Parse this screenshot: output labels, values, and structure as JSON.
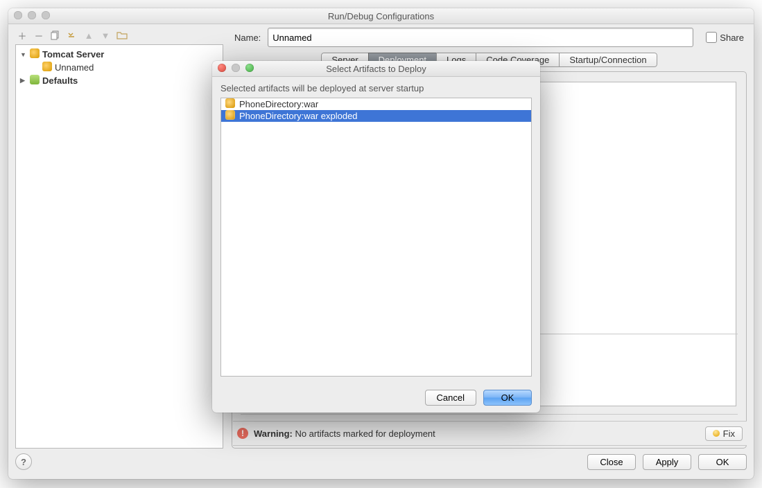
{
  "window": {
    "title": "Run/Debug Configurations"
  },
  "sidebar": {
    "items": [
      {
        "label": "Tomcat Server"
      },
      {
        "label": "Unnamed"
      },
      {
        "label": "Defaults"
      }
    ]
  },
  "main": {
    "name_label": "Name:",
    "name_value": "Unnamed",
    "share_label": "Share",
    "tabs": [
      {
        "label": "Server"
      },
      {
        "label": "Deployment"
      },
      {
        "label": "Logs"
      },
      {
        "label": "Code Coverage"
      },
      {
        "label": "Startup/Connection"
      }
    ]
  },
  "warning": {
    "prefix": "Warning:",
    "text": " No artifacts marked for deployment",
    "fix_label": "Fix"
  },
  "buttons": {
    "close": "Close",
    "apply": "Apply",
    "ok": "OK"
  },
  "modal": {
    "title": "Select Artifacts to Deploy",
    "description": "Selected artifacts will be deployed at server startup",
    "items": [
      {
        "label": "PhoneDirectory:war"
      },
      {
        "label": "PhoneDirectory:war exploded"
      }
    ],
    "cancel": "Cancel",
    "ok": "OK"
  }
}
